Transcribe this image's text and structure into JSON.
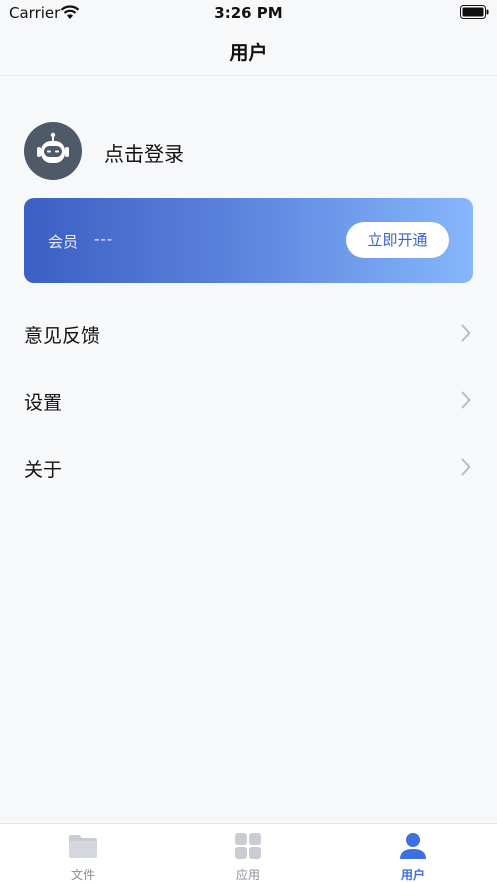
{
  "status_bar": {
    "carrier": "Carrier",
    "time": "3:26 PM"
  },
  "nav": {
    "title": "用户"
  },
  "profile": {
    "login_text": "点击登录"
  },
  "member_card": {
    "label": "会员",
    "value": "---",
    "button_label": "立即开通"
  },
  "menu": [
    {
      "label": "意见反馈"
    },
    {
      "label": "设置"
    },
    {
      "label": "关于"
    }
  ],
  "tabs": [
    {
      "label": "文件",
      "icon": "folder-icon"
    },
    {
      "label": "应用",
      "icon": "apps-grid-icon"
    },
    {
      "label": "用户",
      "icon": "user-icon",
      "active": true
    }
  ],
  "colors": {
    "accent": "#3d6fe0",
    "card_start": "#3b5fc4",
    "card_end": "#86b6fb"
  }
}
